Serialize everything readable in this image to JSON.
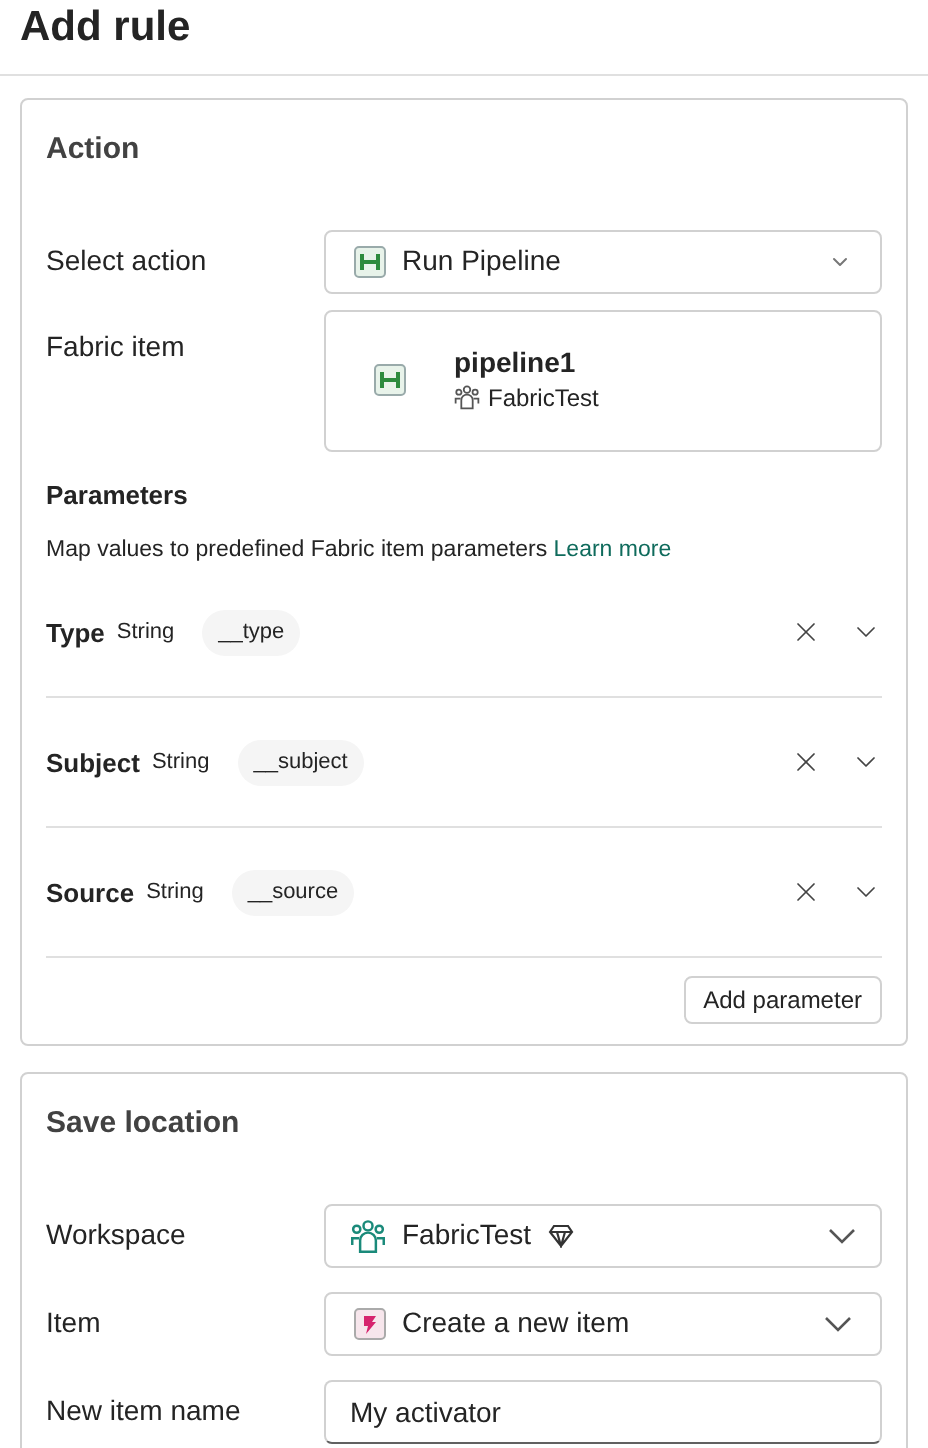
{
  "title": "Add rule",
  "action": {
    "heading": "Action",
    "select_action": {
      "label": "Select action",
      "value": "Run Pipeline"
    },
    "fabric_item": {
      "label": "Fabric item",
      "name": "pipeline1",
      "workspace": "FabricTest"
    },
    "parameters": {
      "heading": "Parameters",
      "description": "Map values to predefined Fabric item parameters",
      "link": "Learn more",
      "items": [
        {
          "name": "Type",
          "type": "String",
          "value": "__type"
        },
        {
          "name": "Subject",
          "type": "String",
          "value": "__subject"
        },
        {
          "name": "Source",
          "type": "String",
          "value": "__source"
        }
      ],
      "add_button": "Add parameter"
    }
  },
  "save_location": {
    "heading": "Save location",
    "workspace": {
      "label": "Workspace",
      "value": "FabricTest"
    },
    "item": {
      "label": "Item",
      "value": "Create a new item"
    },
    "new_item_name": {
      "label": "New item name",
      "value": "My activator"
    }
  }
}
